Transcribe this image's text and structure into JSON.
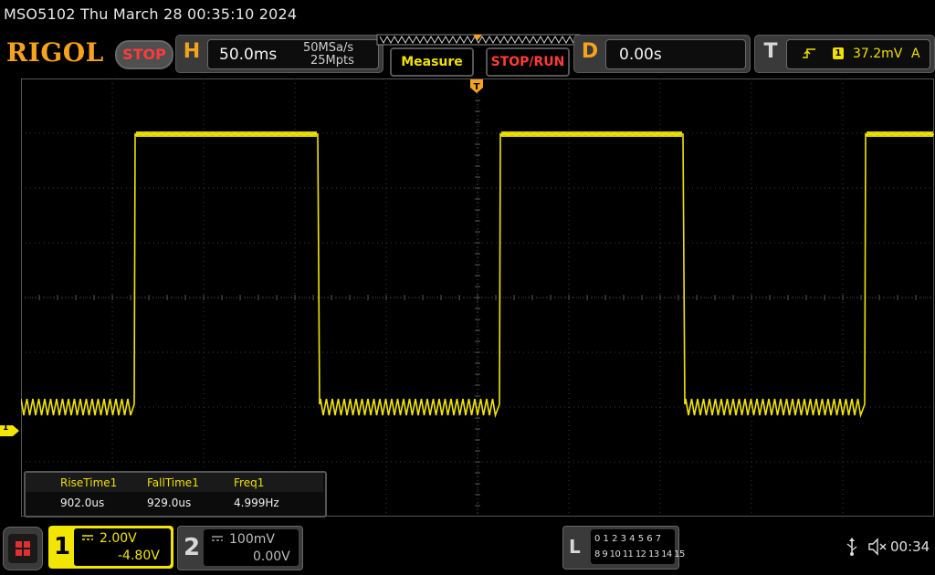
{
  "title_bar": {
    "text": "MSO5102  Thu March 28 00:35:10 2024"
  },
  "brand": {
    "logo": "RIGOL",
    "run_state": "STOP"
  },
  "horizontal": {
    "letter": "H",
    "timebase": "50.0ms",
    "sample_rate": "50MSa/s",
    "memory_depth": "25Mpts"
  },
  "buttons": {
    "measure": "Measure",
    "stop_run": "STOP/RUN"
  },
  "delay": {
    "letter": "D",
    "value": "0.00s"
  },
  "trigger": {
    "letter": "T",
    "source": "1",
    "level": "37.2mV",
    "mode": "A"
  },
  "measurements": [
    {
      "name": "RiseTime1",
      "value": "902.0us"
    },
    {
      "name": "FallTime1",
      "value": "929.0us"
    },
    {
      "name": "Freq1",
      "value": "4.999Hz"
    }
  ],
  "channel1": {
    "number": "1",
    "scale": "2.00V",
    "offset": "-4.80V",
    "marker": "1",
    "color": "#f2e600"
  },
  "channel2": {
    "number": "2",
    "scale": "100mV",
    "offset": "0.00V"
  },
  "logic": {
    "letter": "L",
    "row1": "0 1 2 3  4 5 6 7",
    "row2": "8 9 10 11 12 13 14 15"
  },
  "status": {
    "time": "00:34"
  },
  "colors": {
    "accent_orange": "#f5a21c",
    "stop_red": "#ff3b3b",
    "trace_yellow": "#f2e600"
  }
}
